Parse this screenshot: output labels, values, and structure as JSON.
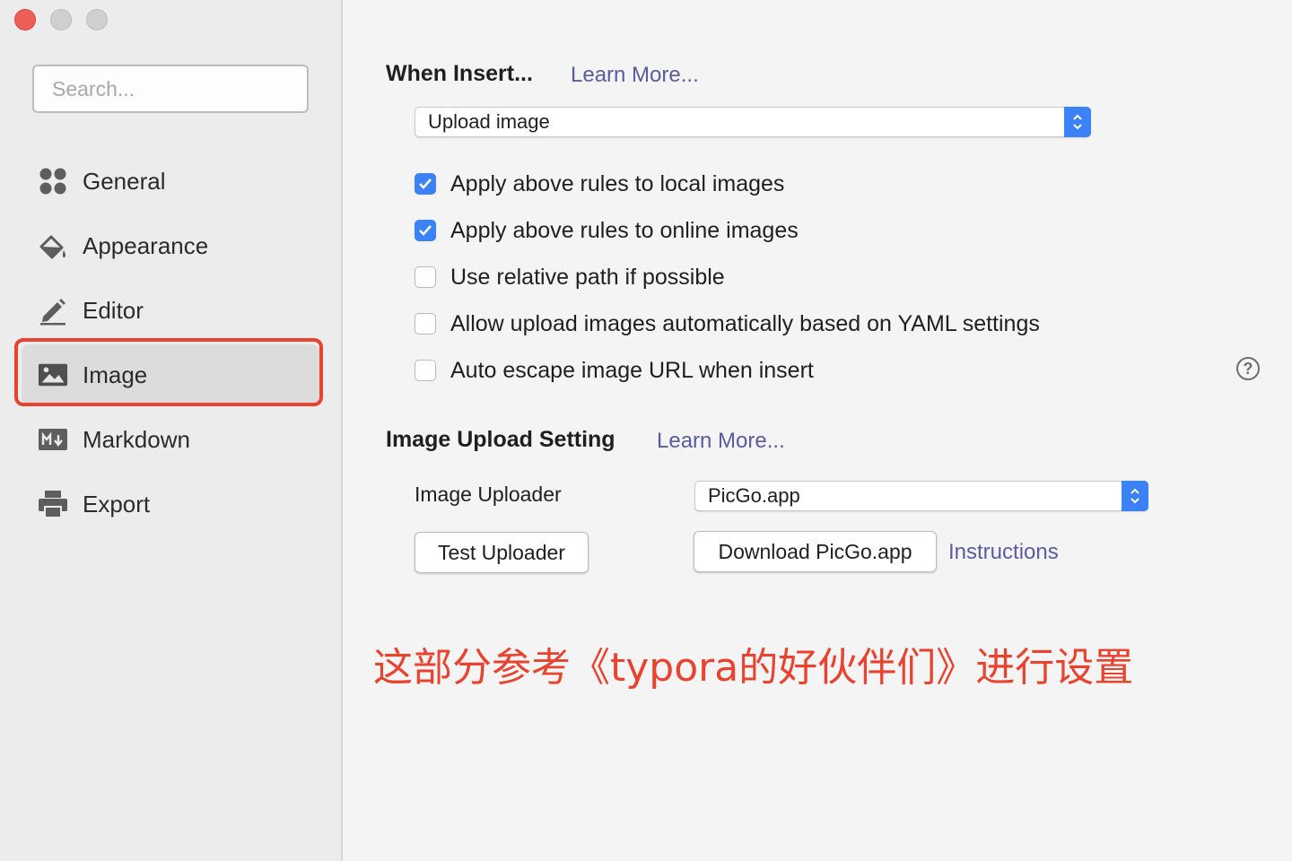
{
  "window": {
    "controls": [
      "close",
      "minimize",
      "zoom"
    ]
  },
  "sidebar": {
    "search_placeholder": "Search...",
    "items": [
      {
        "label": "General",
        "icon": "grid-icon"
      },
      {
        "label": "Appearance",
        "icon": "paint-bucket-icon"
      },
      {
        "label": "Editor",
        "icon": "pencil-icon"
      },
      {
        "label": "Image",
        "icon": "image-icon",
        "selected": true
      },
      {
        "label": "Markdown",
        "icon": "markdown-icon"
      },
      {
        "label": "Export",
        "icon": "printer-icon"
      }
    ]
  },
  "when_insert": {
    "title": "When Insert...",
    "learn_more": "Learn More...",
    "select_value": "Upload image",
    "options": [
      {
        "label": "Apply above rules to local images",
        "checked": true
      },
      {
        "label": "Apply above rules to online images",
        "checked": true
      },
      {
        "label": "Use relative path if possible",
        "checked": false
      },
      {
        "label": "Allow upload images automatically based on YAML settings",
        "checked": false
      },
      {
        "label": "Auto escape image URL when insert",
        "checked": false
      }
    ],
    "help": "?"
  },
  "upload_setting": {
    "title": "Image Upload Setting",
    "learn_more": "Learn More...",
    "uploader_label": "Image Uploader",
    "uploader_value": "PicGo.app",
    "test_button": "Test Uploader",
    "download_button": "Download PicGo.app",
    "instructions_link": "Instructions"
  },
  "annotation": "这部分参考《typora的好伙伴们》进行设置",
  "colors": {
    "accent": "#3b82f6",
    "link": "#5a5ca0",
    "annotation": "#e8432f",
    "close": "#ee5f57"
  }
}
